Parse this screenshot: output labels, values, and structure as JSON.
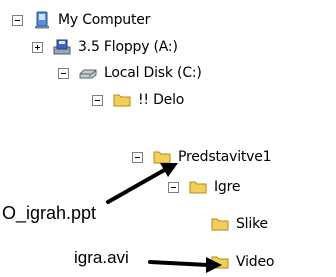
{
  "tree": {
    "my_computer": "My Computer",
    "floppy": "3.5 Floppy (A:)",
    "local_disk": "Local Disk (C:)",
    "delo": "!! Delo",
    "predstavitve": "Predstavitve1",
    "igre": "Igre",
    "slike": "Slike",
    "video": "Video"
  },
  "annotations": {
    "ppt_file": "O_igrah.ppt",
    "avi_file": "igra.avi"
  },
  "colors": {
    "folder_fill": "#f2cf5b",
    "folder_stroke": "#b98a12",
    "toggle_border": "#7f7f7f"
  }
}
